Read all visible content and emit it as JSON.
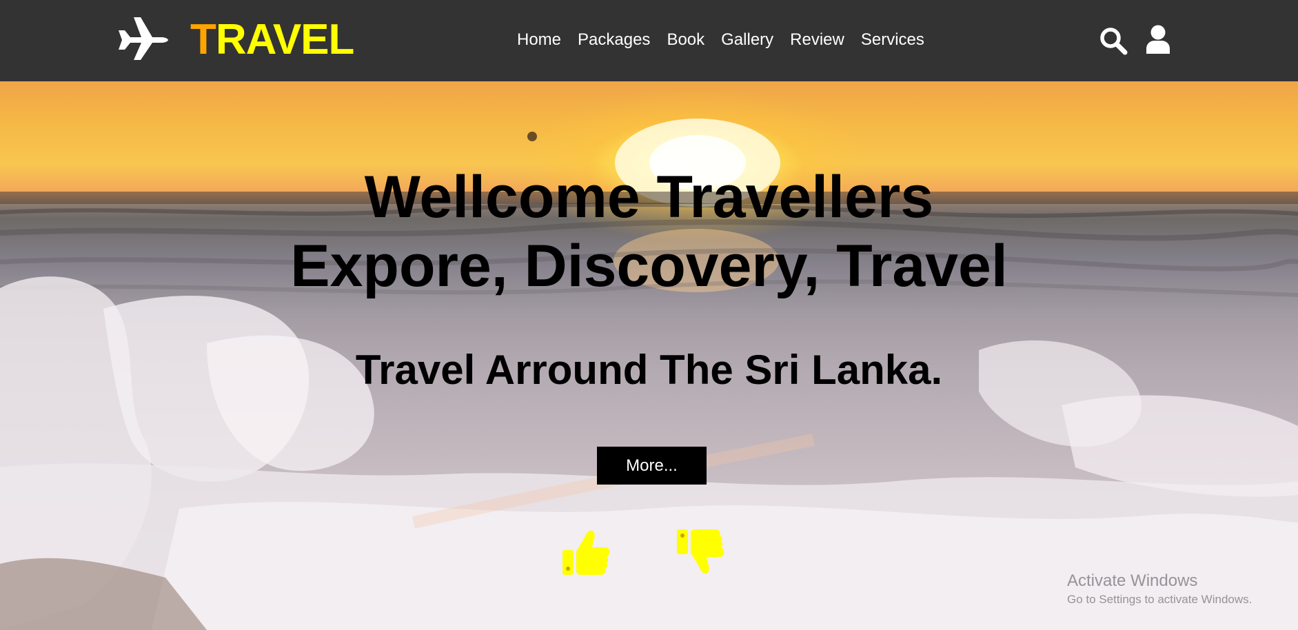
{
  "header": {
    "logo_first_letter": "T",
    "logo_rest": "RAVEL",
    "brand_icon": "plane-icon",
    "nav": [
      {
        "label": "Home"
      },
      {
        "label": "Packages"
      },
      {
        "label": "Book"
      },
      {
        "label": "Gallery"
      },
      {
        "label": "Review"
      },
      {
        "label": "Services"
      }
    ],
    "icons": [
      "search-icon",
      "user-icon"
    ]
  },
  "hero": {
    "heading_line1": "Wellcome Travellers",
    "heading_line2": "Expore, Discovery, Travel",
    "subheading": "Travel Arround The Sri Lanka.",
    "button_label": "More...",
    "reaction_icons": [
      "thumb-up-icon",
      "thumb-down-icon"
    ],
    "background": "sunset over ocean foam"
  },
  "watermark": {
    "title": "Activate Windows",
    "subtitle": "Go to Settings to activate Windows."
  },
  "colors": {
    "header_bg": "#333333",
    "logo_first_letter": "#ffa500",
    "logo_text": "#ffff00",
    "nav_text": "#ffffff",
    "hero_text": "#000000",
    "button_bg": "#000000",
    "button_text": "#ffffff",
    "reaction_icons": "#ffff00"
  }
}
